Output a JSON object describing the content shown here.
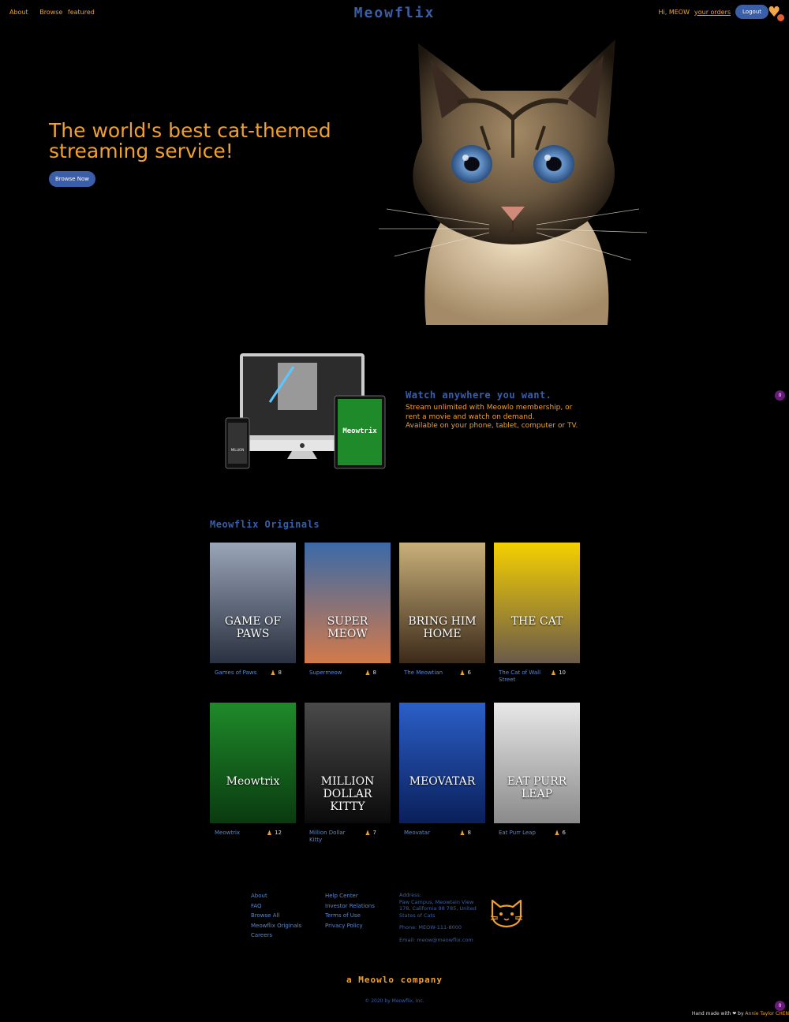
{
  "nav": {
    "left": [
      "About",
      "Browse",
      "featured"
    ],
    "brand": "Meowflix",
    "greeting": "Hi, MEOW",
    "orders": "your orders",
    "logout": "Logout"
  },
  "hero": {
    "title": "The world's best cat-themed streaming service!",
    "button": "Browse Now"
  },
  "watch": {
    "title": "Watch anywhere you want.",
    "line1": "Stream unlimited with Meowlo membership, or rent a movie and watch on demand.",
    "line2": "Available on your phone, tablet, computer or TV."
  },
  "badges": {
    "side": "0",
    "bottom": "0"
  },
  "originals": {
    "title": "Meowflix Originals",
    "items": [
      {
        "title": "Games of Paws",
        "votes": "8",
        "poster_text": "GAME OF PAWS",
        "colors": [
          "#9aa5b8",
          "#2a3140"
        ]
      },
      {
        "title": "Supermeow",
        "votes": "8",
        "poster_text": "SUPER MEOW",
        "colors": [
          "#3a6aa8",
          "#d27a4a"
        ]
      },
      {
        "title": "The Meowtian",
        "votes": "6",
        "poster_text": "BRING HIM HOME",
        "colors": [
          "#c9b07a",
          "#3c2a1a"
        ]
      },
      {
        "title": "The Cat of Wall Street",
        "votes": "10",
        "poster_text": "THE CAT",
        "colors": [
          "#f5d000",
          "#6a5a4a"
        ]
      },
      {
        "title": "Meowtrix",
        "votes": "12",
        "poster_text": "Meowtrix",
        "colors": [
          "#1f8a2a",
          "#0a3a10"
        ]
      },
      {
        "title": "Million Dollar Kitty",
        "votes": "7",
        "poster_text": "MILLION DOLLAR KITTY",
        "colors": [
          "#4a4a4a",
          "#0a0a0a"
        ]
      },
      {
        "title": "Meovatar",
        "votes": "8",
        "poster_text": "MEOVATAR",
        "colors": [
          "#2b5fc8",
          "#0a1f5a"
        ]
      },
      {
        "title": "Eat Purr Leap",
        "votes": "6",
        "poster_text": "EAT PURR LEAP",
        "colors": [
          "#e8e8e8",
          "#8a8a8a"
        ]
      }
    ]
  },
  "footer": {
    "col1": [
      "About",
      "FAQ",
      "Browse All",
      "Meowflix Originals",
      "Careers"
    ],
    "col2": [
      "Help Center",
      "Investor Relations",
      "Terms of Use",
      "Privacy Policy"
    ],
    "address_label": "Address:",
    "address": "Paw Campus, Meowtain View 178, California 98 785, United States of Cats",
    "phone": "Phone: MEOW-111-8000",
    "email": "Email: meow@meowflix.com",
    "company": "a Meowlo company",
    "copyright": "© 2020 by Meowflix, Inc.",
    "handmade": "Hand made with ❤ by",
    "author": "Annie Taylor CHEN"
  }
}
